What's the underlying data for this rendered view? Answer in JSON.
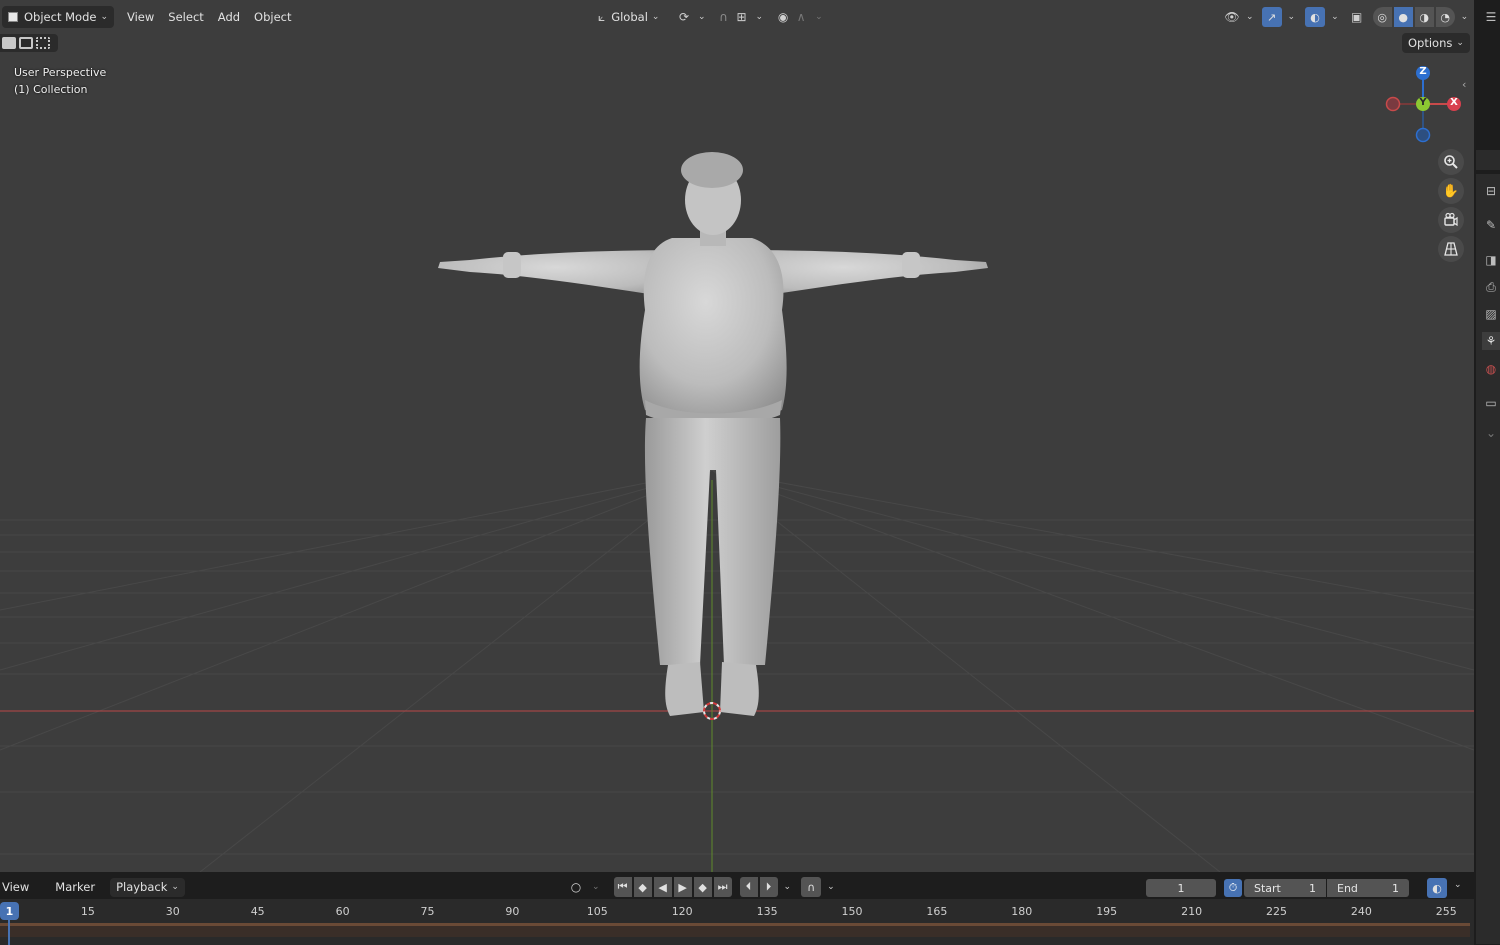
{
  "header": {
    "mode_label": "Object Mode",
    "menus": [
      "View",
      "Select",
      "Add",
      "Object"
    ],
    "transform_orientation": "Global",
    "options_label": "Options"
  },
  "viewport": {
    "view_name": "User Perspective",
    "collection_label": "(1) Collection",
    "gizmo": {
      "z": "Z",
      "y": "Y",
      "x": "X"
    }
  },
  "timeline": {
    "menus": [
      "View",
      "Marker"
    ],
    "playback_label": "Playback",
    "current_frame": "1",
    "start_label": "Start",
    "start_value": "1",
    "end_label": "End",
    "end_value": "1",
    "playhead_label": "1",
    "ticks": [
      "15",
      "30",
      "45",
      "60",
      "75",
      "90",
      "105",
      "120",
      "135",
      "150",
      "165",
      "180",
      "195",
      "210",
      "225",
      "240",
      "255"
    ]
  },
  "colors": {
    "viewport_bg": "#3d3d3d",
    "x_axis": "#c84a4a",
    "y_axis": "#6b9a32",
    "z_axis": "#2d6fd0",
    "accent": "#4772b3"
  }
}
